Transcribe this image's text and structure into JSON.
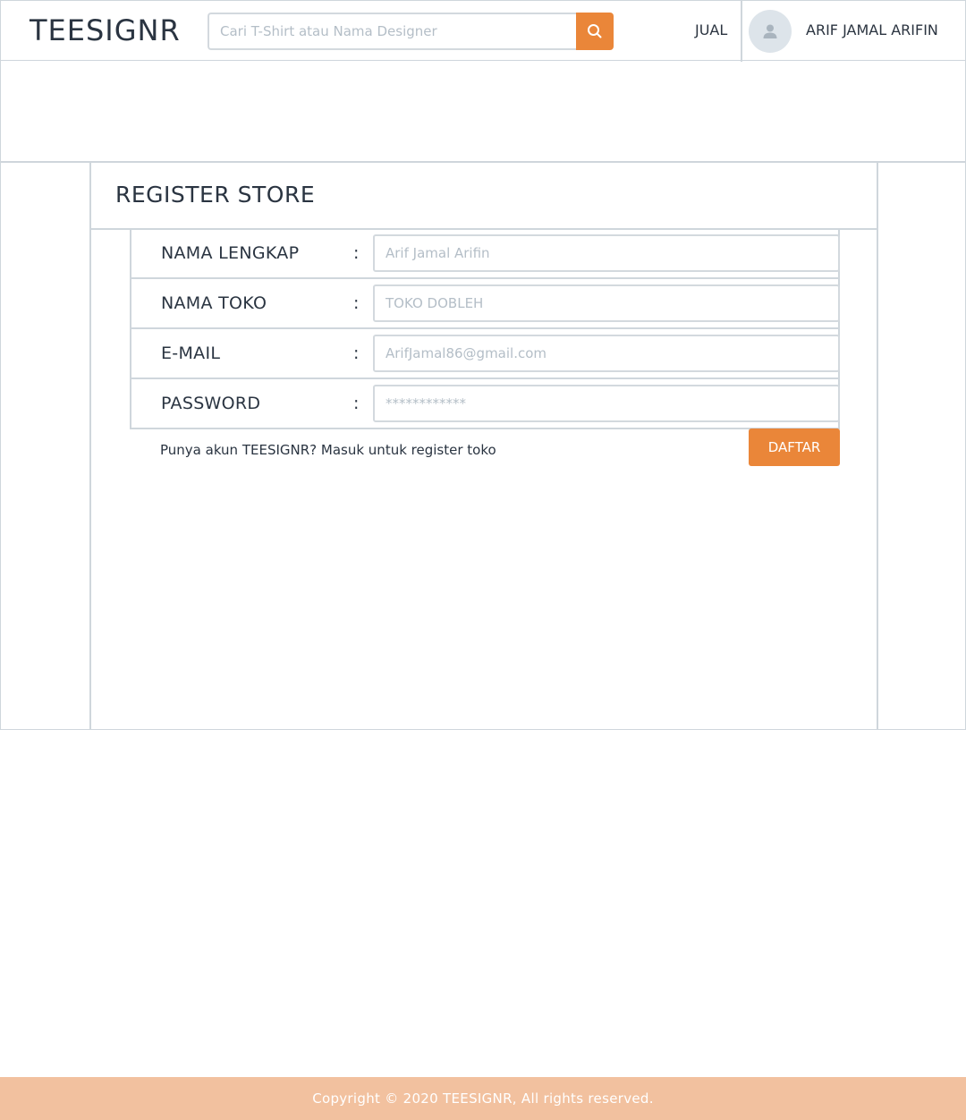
{
  "header": {
    "logo": "TEESIGNR",
    "search": {
      "placeholder": "Cari T-Shirt atau Nama Designer",
      "value": ""
    },
    "search_icon": "search-icon",
    "jual_label": "JUAL",
    "avatar_icon": "user-icon",
    "username": "ARIF JAMAL ARIFIN"
  },
  "page": {
    "title": "REGISTER STORE"
  },
  "form": {
    "fields": [
      {
        "label": "NAMA LENGKAP",
        "separator": ":",
        "placeholder": "Arif Jamal Arifin",
        "value": ""
      },
      {
        "label": "NAMA TOKO",
        "separator": ":",
        "placeholder": "TOKO DOBLEH",
        "value": ""
      },
      {
        "label": "E-MAIL",
        "separator": ":",
        "placeholder": "ArifJamal86@gmail.com",
        "value": ""
      },
      {
        "label": "PASSWORD",
        "separator": ":",
        "placeholder": "************",
        "value": ""
      }
    ],
    "login_prompt": "Punya akun TEESIGNR? Masuk untuk register toko",
    "submit_label": "DAFTAR"
  },
  "footer": {
    "copyright": "Copyright ©  2020 TEESIGNR, All rights reserved."
  },
  "colors": {
    "accent": "#ea8639",
    "footer_bg": "#f2c19f",
    "border": "#cfd6dc",
    "text": "#2a3441"
  }
}
